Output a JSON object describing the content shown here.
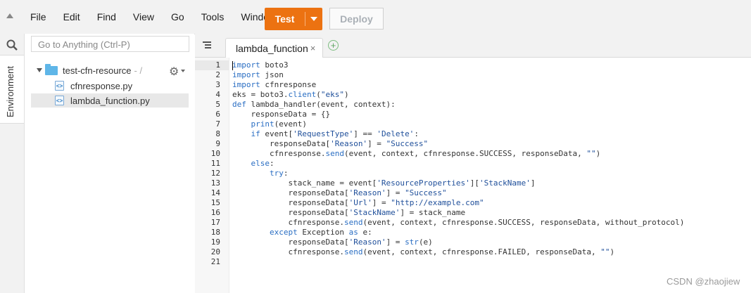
{
  "menu": [
    "File",
    "Edit",
    "Find",
    "View",
    "Go",
    "Tools",
    "Window"
  ],
  "toolbar": {
    "test_label": "Test",
    "deploy_label": "Deploy"
  },
  "sidebar": {
    "env_tab": "Environment",
    "goto_placeholder": "Go to Anything (Ctrl-P)",
    "folder": "test-cfn-resource",
    "folder_suffix": "- /",
    "files": [
      "cfnresponse.py",
      "lambda_function.py"
    ],
    "selected_file": "lambda_function.py"
  },
  "editor": {
    "tab_title": "lambda_function",
    "tab_close": "×",
    "add_tab": "+",
    "lines": [
      "import boto3",
      "import json",
      "import cfnresponse",
      "eks = boto3.client(\"eks\")",
      "def lambda_handler(event, context):",
      "    responseData = {}",
      "    print(event)",
      "    if event['RequestType'] == 'Delete':",
      "        responseData['Reason'] = \"Success\"",
      "        cfnresponse.send(event, context, cfnresponse.SUCCESS, responseData, \"\")",
      "    else:",
      "        try:",
      "            stack_name = event['ResourceProperties']['StackName']",
      "            responseData['Reason'] = \"Success\"",
      "            responseData['Url'] = \"http://example.com\"",
      "            responseData['StackName'] = stack_name",
      "            cfnresponse.send(event, context, cfnresponse.SUCCESS, responseData, without_protocol)",
      "        except Exception as e:",
      "            responseData['Reason'] = str(e)",
      "            cfnresponse.send(event, context, cfnresponse.FAILED, responseData, \"\")",
      ""
    ]
  },
  "watermark": "CSDN @zhaojiew",
  "colors": {
    "accent": "#ec7211",
    "keyword": "#2a6ec3",
    "string": "#1f4f9a"
  }
}
